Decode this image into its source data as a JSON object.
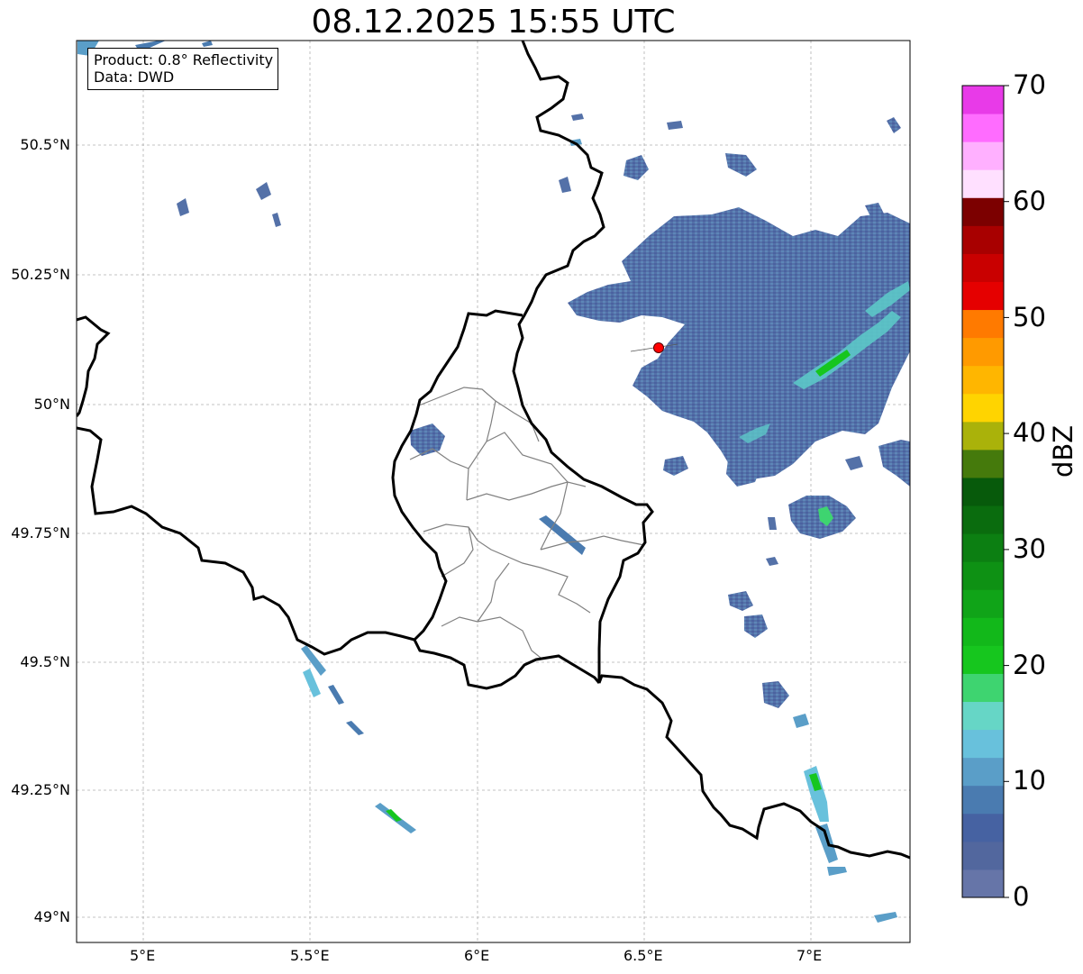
{
  "title": "08.12.2025 15:55 UTC",
  "info": {
    "product": "Product: 0.8° Reflectivity",
    "source": "Data: DWD"
  },
  "lat_ticks": [
    "50.5°N",
    "50.25°N",
    "50°N",
    "49.75°N",
    "49.5°N",
    "49.25°N",
    "49°N"
  ],
  "lon_ticks": [
    "5°E",
    "5.5°E",
    "6°E",
    "6.5°E",
    "7°E"
  ],
  "colorbar": {
    "label": "dBZ",
    "ticks": [
      "0",
      "10",
      "20",
      "30",
      "40",
      "50",
      "60",
      "70"
    ],
    "range": [
      0,
      70
    ],
    "colors": [
      "#6675a8",
      "#52679e",
      "#4662a2",
      "#4a7bb0",
      "#5a9ec8",
      "#68c1dc",
      "#66d6c6",
      "#3ed470",
      "#16c61e",
      "#12b81a",
      "#10a418",
      "#0e9114",
      "#0c7f12",
      "#0a6c0e",
      "#075a0b",
      "#457a0c",
      "#aab20a",
      "#ffd400",
      "#ffb600",
      "#ff9a00",
      "#ff7a00",
      "#e50000",
      "#c90000",
      "#a80000",
      "#7c0000",
      "#ffe0ff",
      "#ffb0ff",
      "#ff6cff",
      "#e83ae8"
    ]
  },
  "radar_site": {
    "lat": 50.11,
    "lon": 6.55
  }
}
